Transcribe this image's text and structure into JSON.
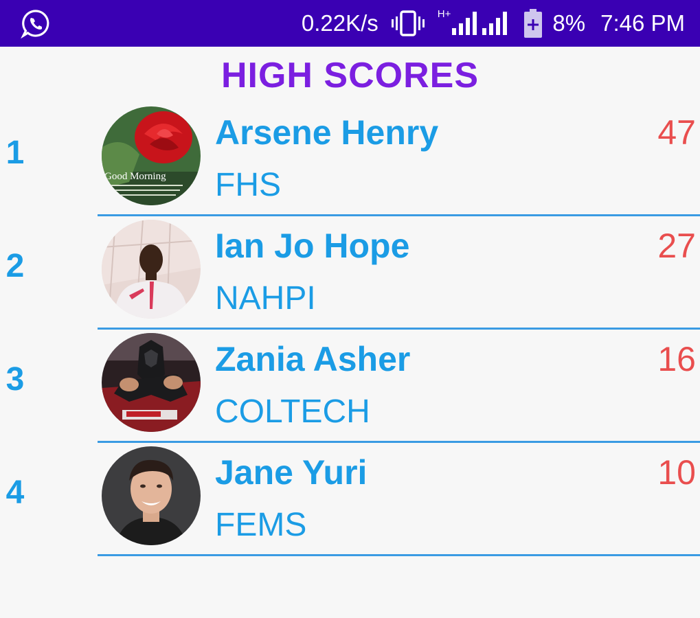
{
  "status_bar": {
    "app_icon": "whatsapp-icon",
    "net_speed": "0.22K/s",
    "vibrate_icon": "vibrate-icon",
    "network_type": "H+",
    "signal_icon": "signal-icon",
    "battery_icon": "battery-charging-icon",
    "battery_percent": "8%",
    "time": "7:46 PM",
    "background_color": "#3a00b3"
  },
  "title": "HIGH SCORES",
  "colors": {
    "title": "#7b1fe0",
    "name": "#1b9ce5",
    "score": "#e94e4e",
    "divider": "#3a9be3"
  },
  "entries": [
    {
      "rank": "1",
      "name": "Arsene Henry",
      "school": "FHS",
      "score": "47",
      "avatar": "rose-good-morning-avatar",
      "avatar_text": "Good Morning"
    },
    {
      "rank": "2",
      "name": "Ian Jo Hope",
      "school": "NAHPI",
      "score": "27",
      "avatar": "man-selfie-avatar"
    },
    {
      "rank": "3",
      "name": "Zania Asher",
      "school": "COLTECH",
      "score": "16",
      "avatar": "black-panther-avatar"
    },
    {
      "rank": "4",
      "name": "Jane Yuri",
      "school": "FEMS",
      "score": "10",
      "avatar": "man-portrait-avatar"
    }
  ]
}
